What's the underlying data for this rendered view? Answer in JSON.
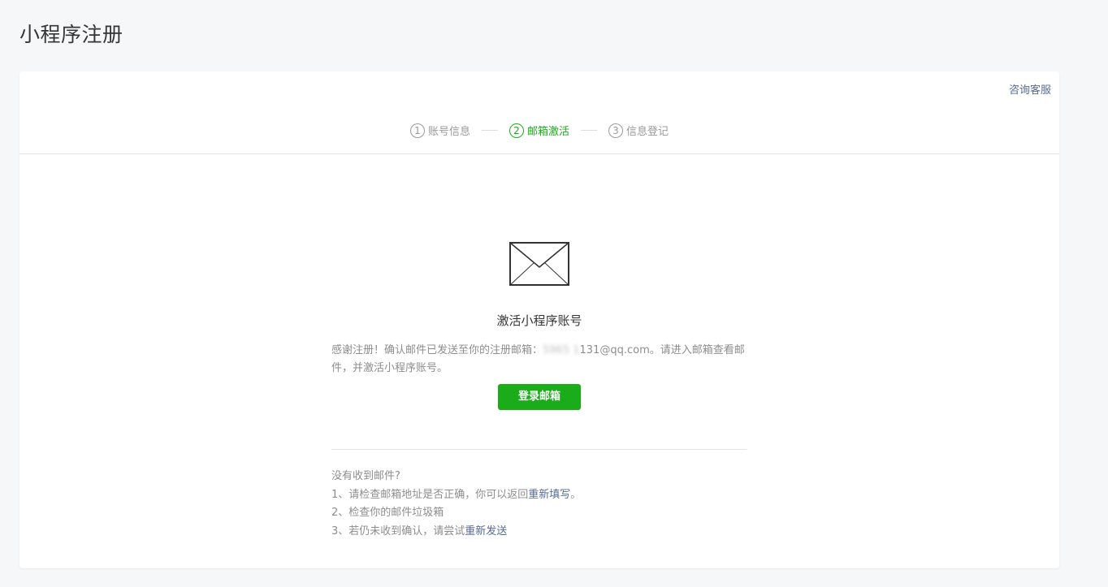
{
  "page": {
    "title": "小程序注册"
  },
  "card": {
    "service_link": "咨询客服"
  },
  "steps": [
    {
      "num": "1",
      "label": "账号信息",
      "state": "done"
    },
    {
      "num": "2",
      "label": "邮箱激活",
      "state": "active"
    },
    {
      "num": "3",
      "label": "信息登记",
      "state": "pending"
    }
  ],
  "colors": {
    "accent": "#1aad19",
    "link": "#576b95",
    "muted": "#9a9a9a"
  },
  "activation": {
    "icon": "envelope-icon",
    "headline": "激活小程序账号",
    "desc_prefix": "感谢注册！确认邮件已发送至你的注册邮箱：",
    "email_masked": "5965  1",
    "email_visible": "131@qq.com",
    "desc_suffix": "。请进入邮箱查看邮件，并激活小程序账号。",
    "login_button": "登录邮箱"
  },
  "help": {
    "title": "没有收到邮件?",
    "item1_prefix": "1、请检查邮箱地址是否正确，你可以返回",
    "item1_link": "重新填写",
    "item1_suffix": "。",
    "item2": "2、检查你的邮件垃圾箱",
    "item3_prefix": "3、若仍未收到确认，请尝试",
    "item3_link": "重新发送"
  }
}
